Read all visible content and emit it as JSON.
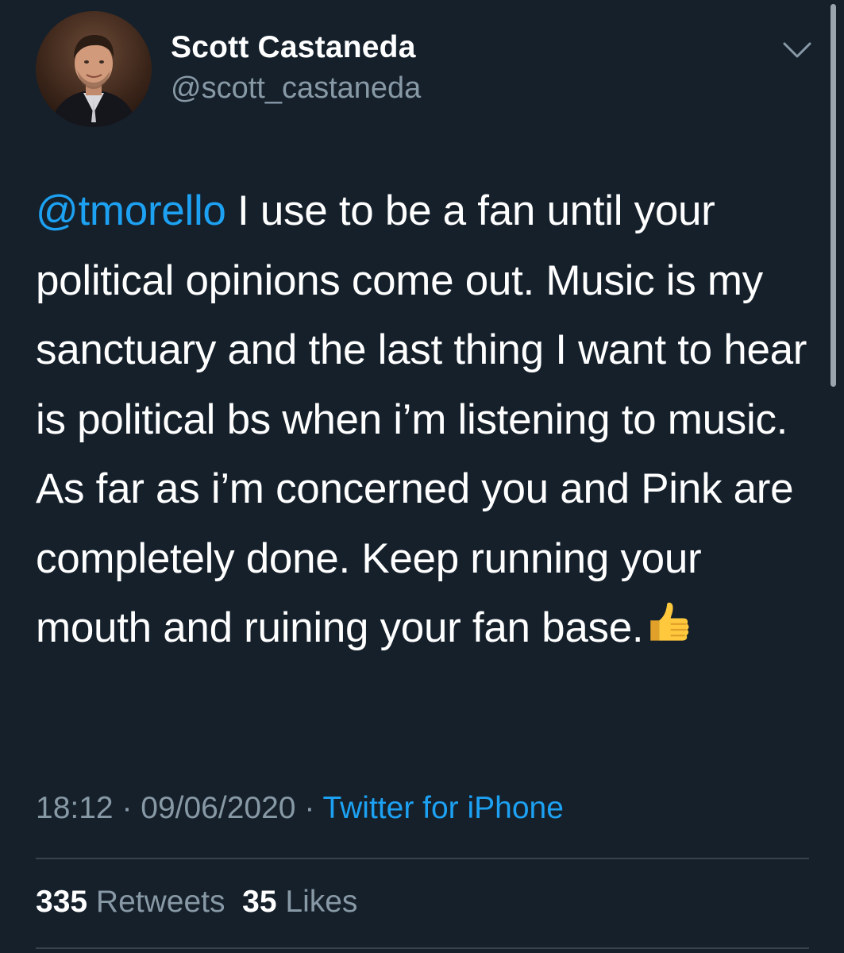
{
  "user": {
    "display_name": "Scott Castaneda",
    "handle": "@scott_castaneda"
  },
  "tweet": {
    "mention": "@tmorello",
    "text": " I use to be a fan until your political opinions come out. Music is my sanctuary and the last thing I want to hear is political bs when i’m listening to music. As far as i’m concerned you and Pink are completely done. Keep running your mouth and ruining your fan base.",
    "emoji": "thumbs-up-icon"
  },
  "meta": {
    "time": "18:12",
    "separator": " · ",
    "date": "09/06/2020",
    "source": "Twitter for iPhone"
  },
  "stats": {
    "retweets_count": "335",
    "retweets_label": " Retweets",
    "likes_count": "35",
    "likes_label": " Likes"
  },
  "colors": {
    "background": "#15202b",
    "link": "#1da1f2",
    "secondary_text": "#8899a6",
    "divider": "#38444d"
  }
}
